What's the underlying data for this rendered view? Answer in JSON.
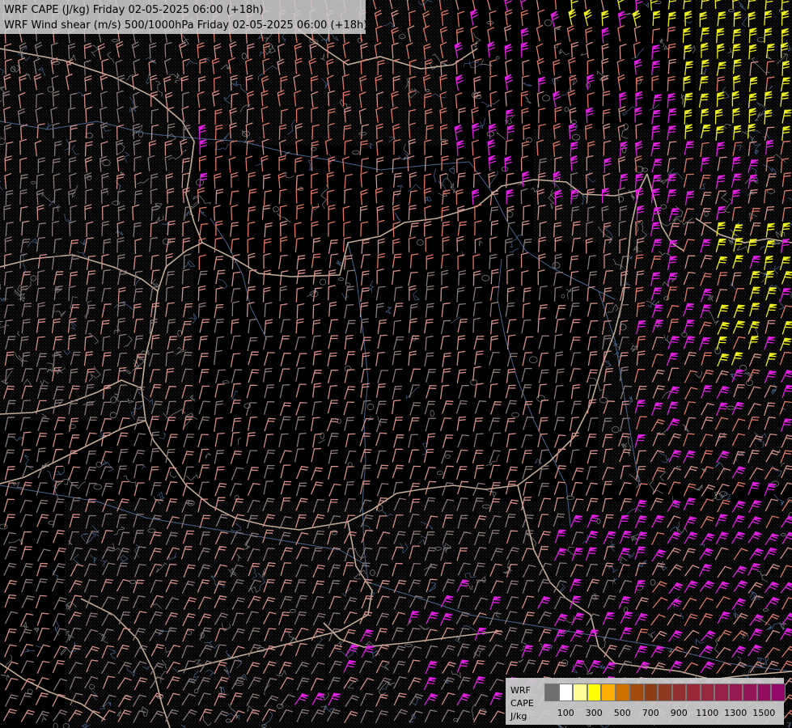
{
  "titles": {
    "line1": "WRF CAPE (J/kg) Friday 02-05-2025 06:00 (+18h)",
    "line2": "WRF Wind shear (m/s) 500/1000hPa Friday 02-05-2025 06:00 (+18h)"
  },
  "legend": {
    "label_model": "WRF",
    "label_field": "CAPE",
    "label_unit": "J/kg",
    "swatches": [
      "#6e6e6e",
      "#ffffff",
      "#ffff99",
      "#ffff00",
      "#ffb000",
      "#cc7000",
      "#a04a10",
      "#8a3c14",
      "#8c3a22",
      "#923030",
      "#982838",
      "#962840",
      "#962048",
      "#941a50",
      "#941458",
      "#920e60",
      "#900868"
    ],
    "ticks": [
      {
        "label": "100",
        "index": 1
      },
      {
        "label": "300",
        "index": 3
      },
      {
        "label": "500",
        "index": 5
      },
      {
        "label": "700",
        "index": 7
      },
      {
        "label": "900",
        "index": 9
      },
      {
        "label": "1100",
        "index": 11
      },
      {
        "label": "1300",
        "index": 13
      },
      {
        "label": "1500",
        "index": 15
      }
    ]
  },
  "barb_colors": {
    "gray": "#8a7a78",
    "salmon": "#d8908a",
    "coral": "#e07868",
    "magenta": "#e020e0",
    "yellow": "#f0f020",
    "contour": "#5878a8",
    "border": "#d8c0a8"
  }
}
